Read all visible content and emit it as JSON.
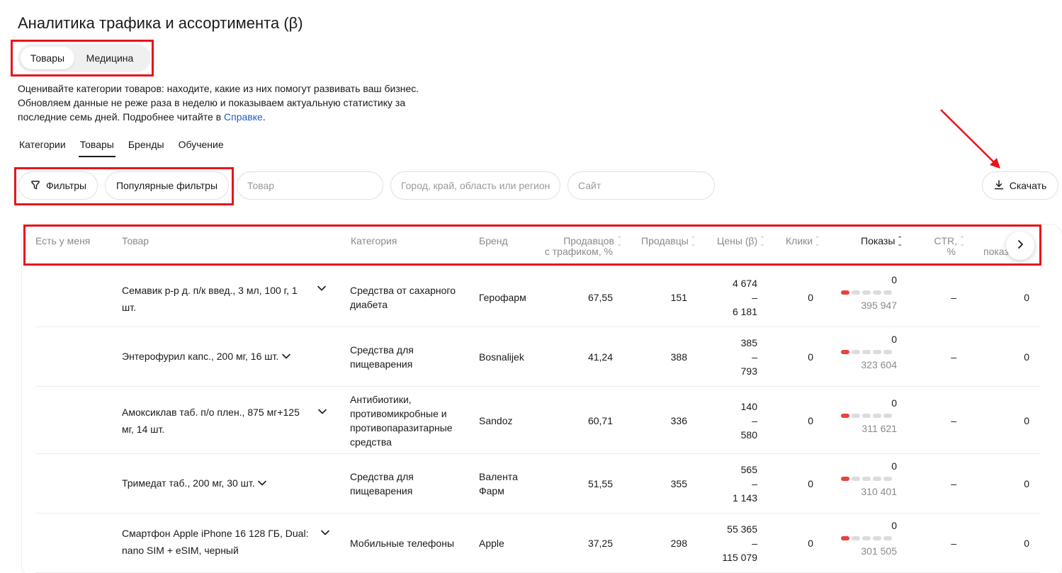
{
  "page_title": "Аналитика трафика и ассортимента (β)",
  "segment": {
    "items": [
      {
        "label": "Товары",
        "active": true
      },
      {
        "label": "Медицина",
        "active": false
      }
    ]
  },
  "description": {
    "text": "Оценивайте категории товаров: находите, какие из них помогут развивать ваш бизнес. Обновляем данные не реже раза в неделю и показываем актуальную статистику за последние семь дней. Подробнее читайте в",
    "link": "Справке",
    "end": "."
  },
  "tabs": [
    {
      "label": "Категории",
      "active": false
    },
    {
      "label": "Товары",
      "active": true
    },
    {
      "label": "Бренды",
      "active": false
    },
    {
      "label": "Обучение",
      "active": false
    }
  ],
  "filters": {
    "filters_label": "Фильтры",
    "popular_label": "Популярные фильтры",
    "product_placeholder": "Товар",
    "region_placeholder": "Город, край, область или регион",
    "site_placeholder": "Сайт",
    "download_label": "Скачать"
  },
  "table": {
    "headers": {
      "have": "Есть у меня",
      "product": "Товар",
      "category": "Категория",
      "brand": "Бренд",
      "sellers_traffic_1": "Продавцов",
      "sellers_traffic_2": "с трафиком, %",
      "sellers": "Продавцы",
      "prices": "Цены (β)",
      "clicks": "Клики",
      "shows": "Показы",
      "ctr_1": "CTR,",
      "ctr_2": "%",
      "extra": "показ"
    },
    "rows": [
      {
        "product": "Семавик р-р д. п/к введ., 3 мл, 100 г, 1 шт.",
        "category": "Средства от сахарного диабета",
        "brand": "Герофарм",
        "sellers_traffic": "67,55",
        "sellers": "151",
        "price_min": "4 674",
        "price_sep": "–",
        "price_max": "6 181",
        "clicks": "0",
        "shows": "0",
        "shows_level": 1,
        "shows_total": "395 947",
        "ctr": "–",
        "extra": "0"
      },
      {
        "product": "Энтерофурил капс., 200 мг, 16 шт.",
        "category": "Средства для пищеварения",
        "brand": "Bosnalijek",
        "sellers_traffic": "41,24",
        "sellers": "388",
        "price_min": "385",
        "price_sep": "–",
        "price_max": "793",
        "clicks": "0",
        "shows": "0",
        "shows_level": 1,
        "shows_total": "323 604",
        "ctr": "–",
        "extra": "0"
      },
      {
        "product": "Амоксиклав таб. п/о плен., 875 мг+125 мг, 14 шт.",
        "category": "Антибиотики, противомикробные и противопаразитарные средства",
        "brand": "Sandoz",
        "sellers_traffic": "60,71",
        "sellers": "336",
        "price_min": "140",
        "price_sep": "–",
        "price_max": "580",
        "clicks": "0",
        "shows": "0",
        "shows_level": 1,
        "shows_total": "311 621",
        "ctr": "–",
        "extra": "0"
      },
      {
        "product": "Тримедат таб., 200 мг, 30 шт.",
        "category": "Средства для пищеварения",
        "brand": "Валента Фарм",
        "sellers_traffic": "51,55",
        "sellers": "355",
        "price_min": "565",
        "price_sep": "–",
        "price_max": "1 143",
        "clicks": "0",
        "shows": "0",
        "shows_level": 1,
        "shows_total": "310 401",
        "ctr": "–",
        "extra": "0"
      },
      {
        "product": "Смартфон Apple iPhone 16 128 ГБ, Dual: nano SIM + eSIM, черный",
        "category": "Мобильные телефоны",
        "brand": "Apple",
        "sellers_traffic": "37,25",
        "sellers": "298",
        "price_min": "55 365",
        "price_sep": "–",
        "price_max": "115 079",
        "clicks": "0",
        "shows": "0",
        "shows_level": 1,
        "shows_total": "301 505",
        "ctr": "–",
        "extra": "0"
      }
    ]
  },
  "colors": {
    "annotation": "#e8141b",
    "bar_active": "#e8423a",
    "link": "#1d5fc0"
  }
}
